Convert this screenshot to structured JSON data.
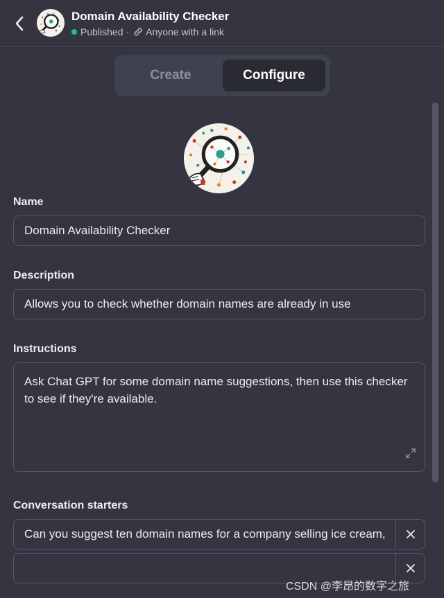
{
  "header": {
    "title": "Domain Availability Checker",
    "status": "Published",
    "separator": "·",
    "visibility": "Anyone with a link",
    "back_icon": "chevron-left-icon",
    "link_icon": "link-icon",
    "status_color": "#19c37d"
  },
  "tabs": [
    {
      "label": "Create",
      "active": false
    },
    {
      "label": "Configure",
      "active": true
    }
  ],
  "form": {
    "name_label": "Name",
    "name_value": "Domain Availability Checker",
    "description_label": "Description",
    "description_value": "Allows you to check whether domain names are already in use",
    "instructions_label": "Instructions",
    "instructions_value": "Ask Chat GPT for some domain name suggestions, then use this checker to see if they're available.",
    "starters_label": "Conversation starters",
    "starters": [
      "Can you suggest ten domain names for a company selling ice cream,",
      ""
    ]
  },
  "watermark": "CSDN @李昂的数字之旅",
  "colors": {
    "background": "#343541",
    "tab_bar": "#40414f",
    "active_tab": "#2a2b32",
    "border": "#565869"
  }
}
